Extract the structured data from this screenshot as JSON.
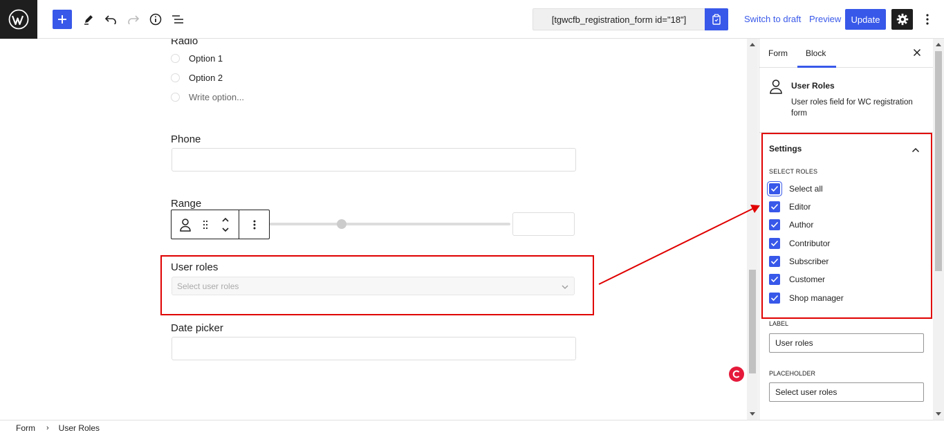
{
  "topbar": {
    "shortcode": "[tgwcfb_registration_form id=\"18\"]",
    "switch_to_draft": "Switch to draft",
    "preview": "Preview",
    "update": "Update"
  },
  "canvas": {
    "radio_label": "Radio",
    "radio_options": [
      "Option 1",
      "Option 2",
      "Write option..."
    ],
    "phone_label": "Phone",
    "range_label": "Range",
    "user_roles_label": "User roles",
    "user_roles_placeholder": "Select user roles",
    "date_picker_label": "Date picker"
  },
  "sidebar": {
    "tabs": [
      "Form",
      "Block"
    ],
    "block_title": "User Roles",
    "block_description": "User roles field for WC registration form",
    "settings_title": "Settings",
    "select_roles_label": "SELECT ROLES",
    "roles": [
      "Select all",
      "Editor",
      "Author",
      "Contributor",
      "Subscriber",
      "Customer",
      "Shop manager"
    ],
    "label_field_label": "LABEL",
    "label_field_value": "User roles",
    "placeholder_field_label": "PLACEHOLDER",
    "placeholder_field_value": "Select user roles"
  },
  "footer": {
    "breadcrumb": [
      "Form",
      "User Roles"
    ]
  },
  "colors": {
    "accent": "#3858e9",
    "highlight": "#e00000"
  }
}
